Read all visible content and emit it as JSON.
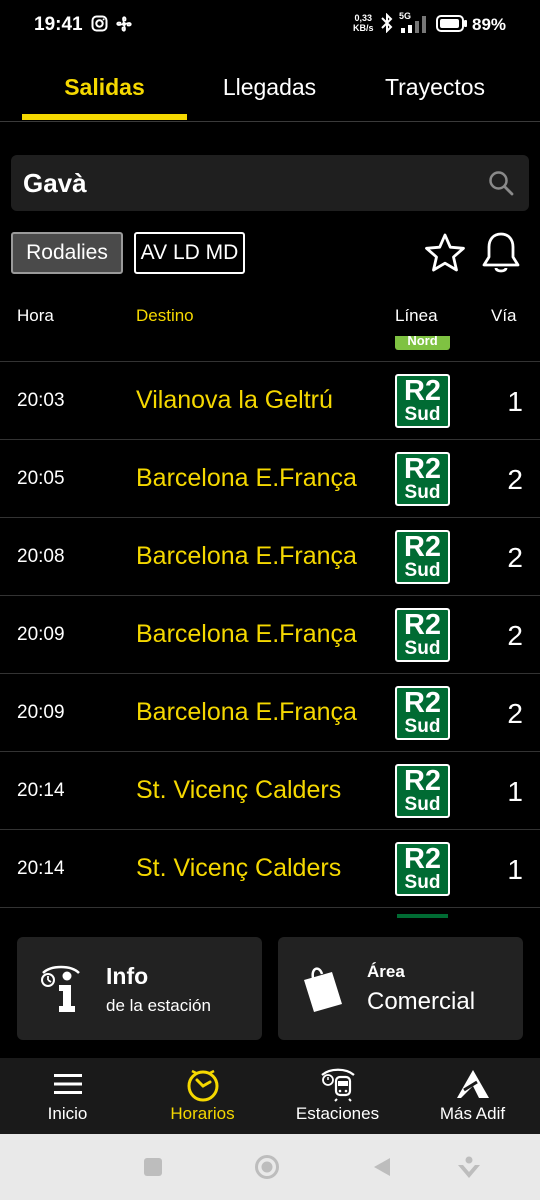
{
  "status_bar": {
    "time": "19:41",
    "net_speed_value": "0,33",
    "net_speed_unit": "KB/s",
    "network": "5G",
    "battery": "89%"
  },
  "tabs": [
    {
      "label": "Salidas",
      "active": true
    },
    {
      "label": "Llegadas",
      "active": false
    },
    {
      "label": "Trayectos",
      "active": false
    }
  ],
  "search": {
    "value": "Gavà"
  },
  "filters": [
    {
      "label": "Rodalies",
      "selected": true
    },
    {
      "label": "AV LD MD",
      "selected": false
    }
  ],
  "table": {
    "headers": {
      "time": "Hora",
      "destination": "Destino",
      "line": "Línea",
      "track": "Vía"
    },
    "partial_top_badge": "Nord",
    "rows": [
      {
        "time": "20:03",
        "destination": "Vilanova la Geltrú",
        "line": "R2",
        "line_sub": "Sud",
        "track": "1"
      },
      {
        "time": "20:05",
        "destination": "Barcelona E.França",
        "line": "R2",
        "line_sub": "Sud",
        "track": "2"
      },
      {
        "time": "20:08",
        "destination": "Barcelona E.França",
        "line": "R2",
        "line_sub": "Sud",
        "track": "2"
      },
      {
        "time": "20:09",
        "destination": "Barcelona E.França",
        "line": "R2",
        "line_sub": "Sud",
        "track": "2"
      },
      {
        "time": "20:09",
        "destination": "Barcelona E.França",
        "line": "R2",
        "line_sub": "Sud",
        "track": "2"
      },
      {
        "time": "20:14",
        "destination": "St. Vicenç Calders",
        "line": "R2",
        "line_sub": "Sud",
        "track": "1"
      },
      {
        "time": "20:14",
        "destination": "St. Vicenç Calders",
        "line": "R2",
        "line_sub": "Sud",
        "track": "1"
      }
    ]
  },
  "cards": {
    "info": {
      "title": "Info",
      "subtitle": "de la estación"
    },
    "commercial": {
      "title": "Área",
      "subtitle": "Comercial"
    }
  },
  "bottom_nav": [
    {
      "label": "Inicio",
      "icon": "menu-icon",
      "active": false
    },
    {
      "label": "Horarios",
      "icon": "clock-icon",
      "active": true
    },
    {
      "label": "Estaciones",
      "icon": "station-icon",
      "active": false
    },
    {
      "label": "Más Adif",
      "icon": "adif-logo-icon",
      "active": false
    }
  ],
  "colors": {
    "accent": "#f5d800",
    "line_r2": "#006b33",
    "line_nord": "#7fc242",
    "background": "#000000"
  }
}
